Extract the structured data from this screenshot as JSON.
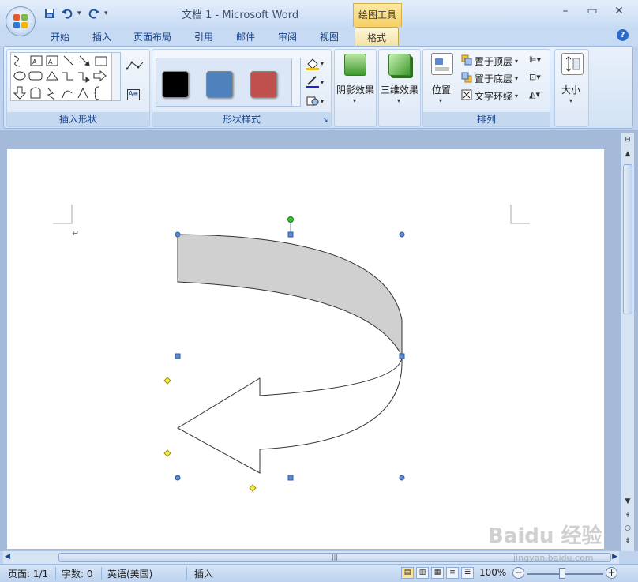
{
  "app": {
    "title": "文档 1 - Microsoft Word",
    "context_tab_group": "绘图工具"
  },
  "window_controls": {
    "minimize": "–",
    "maximize": "▭",
    "close": "✕"
  },
  "quick_access": {
    "save_icon": "save-icon",
    "undo_icon": "undo-icon",
    "redo_icon": "redo-icon",
    "customize": "▾"
  },
  "tabs": [
    "开始",
    "插入",
    "页面布局",
    "引用",
    "邮件",
    "审阅",
    "视图"
  ],
  "active_tab": "格式",
  "help_glyph": "?",
  "ribbon": {
    "insert_shapes": {
      "label": "插入形状"
    },
    "shape_styles": {
      "label": "形状样式",
      "swatches": [
        "#000000",
        "#4f81bd",
        "#c0504d"
      ]
    },
    "shadow": {
      "label": "阴影效果"
    },
    "threed": {
      "label": "三维效果"
    },
    "arrange": {
      "label": "排列",
      "position": "位置",
      "bring_front": "置于顶层",
      "send_back": "置于底层",
      "text_wrap": "文字环绕"
    },
    "size": {
      "label": "大小"
    }
  },
  "document": {
    "paragraph_mark": "↵"
  },
  "statusbar": {
    "page": "页面: 1/1",
    "words": "字数: 0",
    "language": "英语(美国)",
    "mode": "插入",
    "zoom": "100%",
    "zoom_minus": "−",
    "zoom_plus": "+"
  },
  "watermark": {
    "brand": "Baidu 经验",
    "url": "jingyan.baidu.com"
  },
  "colors": {
    "arrow_fill_top": "#d0d0d0",
    "handle_blue": "#5b8dd6",
    "handle_green": "#35c935",
    "handle_yellow": "#f3ec3b"
  }
}
